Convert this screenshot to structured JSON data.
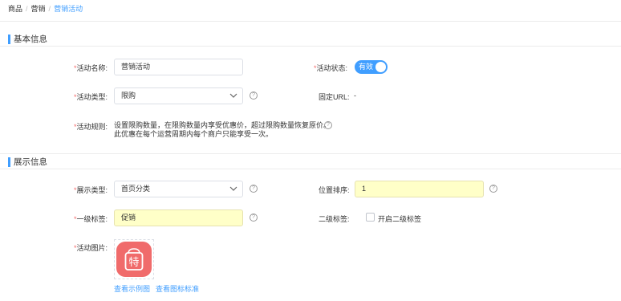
{
  "breadcrumb": {
    "items": [
      "商品",
      "营销"
    ],
    "current": "营销活动",
    "separator": "/"
  },
  "sections": {
    "basic": "基本信息",
    "display": "展示信息"
  },
  "form": {
    "required_mark": "*",
    "activity_name": {
      "label": "活动名称:",
      "value": "营销活动"
    },
    "activity_status": {
      "label": "活动状态:",
      "toggle_text": "有效",
      "on": true
    },
    "activity_type": {
      "label": "活动类型:",
      "value": "限购"
    },
    "fixed_url": {
      "label": "固定URL:",
      "value": "-"
    },
    "activity_rule": {
      "label": "活动规则:",
      "line1": "设置限购数量，在限购数量内享受优惠价，超过限购数量恢复原价。",
      "line2": "此优惠在每个运营周期内每个商户只能享受一次。"
    },
    "display_type": {
      "label": "展示类型:",
      "value": "首页分类"
    },
    "position_sort": {
      "label": "位置排序:",
      "value": "1"
    },
    "tag_level1": {
      "label": "一级标签:",
      "value": "促销"
    },
    "tag_level2": {
      "label": "二级标签:",
      "checkbox_label": "开启二级标签",
      "checked": false
    },
    "activity_image": {
      "label": "活动图片:",
      "icon_char": "特",
      "link_example": "查看示例图",
      "link_standard": "查看图标标准"
    },
    "help": "?"
  },
  "colors": {
    "accent": "#409eff",
    "required": "#f56c6c",
    "highlight": "#ffffc8",
    "icon_bg": "#f06b6b"
  }
}
